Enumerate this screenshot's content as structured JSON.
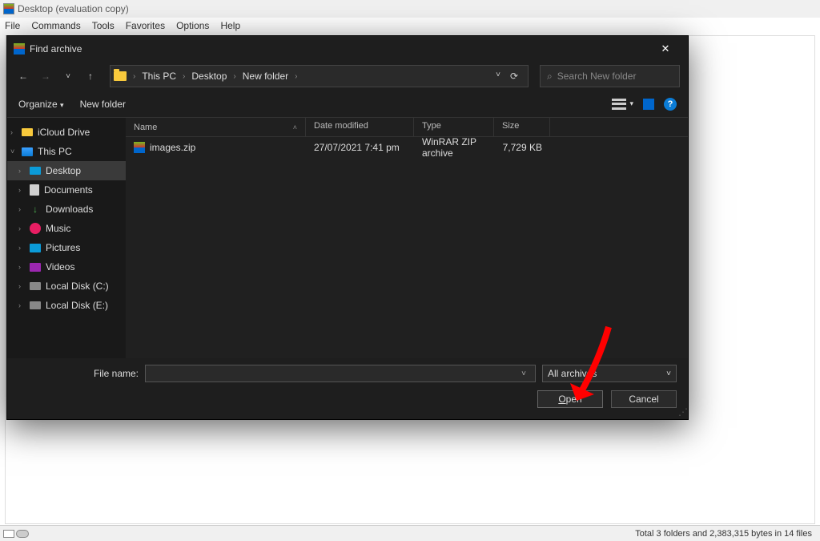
{
  "mainwin": {
    "title": "Desktop (evaluation copy)",
    "menu": [
      "File",
      "Commands",
      "Tools",
      "Favorites",
      "Options",
      "Help"
    ]
  },
  "statusbar": {
    "text": "Total 3 folders and 2,383,315 bytes in 14 files"
  },
  "dialog": {
    "title": "Find archive",
    "breadcrumb": [
      "This PC",
      "Desktop",
      "New folder"
    ],
    "search_placeholder": "Search New folder",
    "organize": "Organize",
    "newfolder": "New folder",
    "columns": {
      "name": "Name",
      "date": "Date modified",
      "type": "Type",
      "size": "Size"
    },
    "files": [
      {
        "name": "images.zip",
        "date": "27/07/2021 7:41 pm",
        "type": "WinRAR ZIP archive",
        "size": "7,729 KB"
      }
    ],
    "sidebar": [
      {
        "label": "iCloud Drive",
        "lvl": 0,
        "exp": ">",
        "ico": "cloud"
      },
      {
        "label": "This PC",
        "lvl": 0,
        "exp": "v",
        "ico": "pc"
      },
      {
        "label": "Desktop",
        "lvl": 1,
        "exp": ">",
        "ico": "desk",
        "sel": true
      },
      {
        "label": "Documents",
        "lvl": 1,
        "exp": ">",
        "ico": "doc"
      },
      {
        "label": "Downloads",
        "lvl": 1,
        "exp": ">",
        "ico": "down"
      },
      {
        "label": "Music",
        "lvl": 1,
        "exp": ">",
        "ico": "mus"
      },
      {
        "label": "Pictures",
        "lvl": 1,
        "exp": ">",
        "ico": "pic"
      },
      {
        "label": "Videos",
        "lvl": 1,
        "exp": ">",
        "ico": "vid"
      },
      {
        "label": "Local Disk (C:)",
        "lvl": 1,
        "exp": ">",
        "ico": "disk"
      },
      {
        "label": "Local Disk (E:)",
        "lvl": 1,
        "exp": ">",
        "ico": "disk"
      }
    ],
    "filename_label": "File name:",
    "filename_value": "",
    "filter": "All archives",
    "open": "Open",
    "cancel": "Cancel"
  }
}
